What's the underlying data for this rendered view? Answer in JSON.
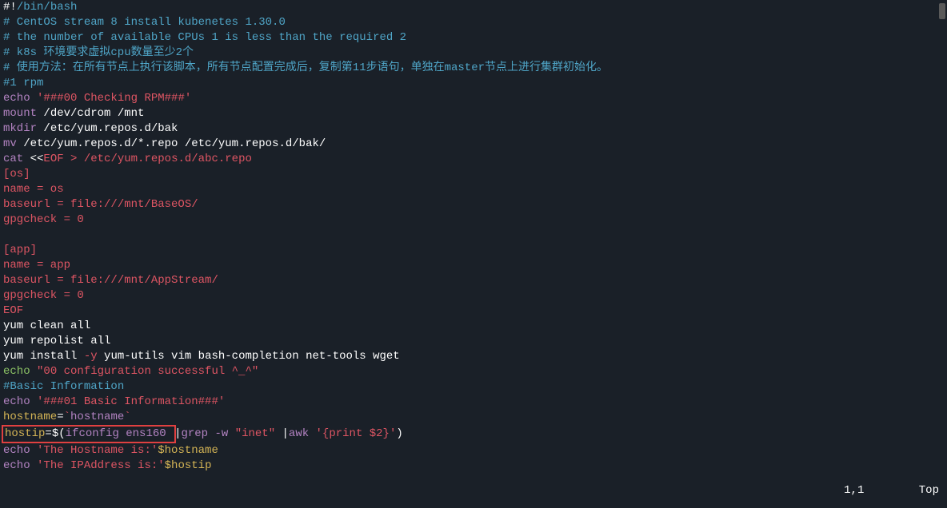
{
  "status": {
    "pos": "1,1",
    "top": "Top"
  },
  "lines": [
    {
      "segs": [
        {
          "t": "#!",
          "c": "white"
        },
        {
          "t": "/bin/bash",
          "c": "comment-blue"
        }
      ]
    },
    {
      "segs": [
        {
          "t": "# CentOS stream 8 install kubenetes 1.30.0",
          "c": "comment-blue"
        }
      ]
    },
    {
      "segs": [
        {
          "t": "# the number of available CPUs 1 is less than the required 2",
          "c": "comment-blue"
        }
      ]
    },
    {
      "segs": [
        {
          "t": "# k8s 环境要求虚拟cpu数量至少2个",
          "c": "comment-blue"
        }
      ]
    },
    {
      "segs": [
        {
          "t": "# 使用方法：在所有节点上执行该脚本，所有节点配置完成后，复制第11步语句，单独在master节点上进行集群初始化。",
          "c": "comment-blue"
        }
      ]
    },
    {
      "segs": [
        {
          "t": "#1 rpm",
          "c": "comment-blue"
        }
      ]
    },
    {
      "segs": [
        {
          "t": "echo ",
          "c": "purple"
        },
        {
          "t": "'###00 Checking RPM###'",
          "c": "red"
        }
      ]
    },
    {
      "segs": [
        {
          "t": "mount ",
          "c": "purple"
        },
        {
          "t": "/dev/cdrom /mnt",
          "c": "white"
        }
      ]
    },
    {
      "segs": [
        {
          "t": "mkdir ",
          "c": "purple"
        },
        {
          "t": "/etc/yum.repos.d/bak",
          "c": "white"
        }
      ]
    },
    {
      "segs": [
        {
          "t": "mv ",
          "c": "purple"
        },
        {
          "t": "/etc/yum.repos.d/*.repo /etc/yum.repos.d/bak/",
          "c": "white"
        }
      ]
    },
    {
      "segs": [
        {
          "t": "cat ",
          "c": "purple"
        },
        {
          "t": "<<",
          "c": "white"
        },
        {
          "t": "EOF",
          "c": "red"
        },
        {
          "t": " > /etc/yum.repos.d/abc.repo",
          "c": "red"
        }
      ]
    },
    {
      "segs": [
        {
          "t": "[os]",
          "c": "red"
        }
      ]
    },
    {
      "segs": [
        {
          "t": "name = os",
          "c": "red"
        }
      ]
    },
    {
      "segs": [
        {
          "t": "baseurl = file:///mnt/BaseOS/",
          "c": "red"
        }
      ]
    },
    {
      "segs": [
        {
          "t": "gpgcheck = 0",
          "c": "red"
        }
      ]
    },
    {
      "segs": [
        {
          "t": "",
          "c": "red"
        }
      ]
    },
    {
      "segs": [
        {
          "t": "[app]",
          "c": "red"
        }
      ]
    },
    {
      "segs": [
        {
          "t": "name = app",
          "c": "red"
        }
      ]
    },
    {
      "segs": [
        {
          "t": "baseurl = file:///mnt/AppStream/",
          "c": "red"
        }
      ]
    },
    {
      "segs": [
        {
          "t": "gpgcheck = 0",
          "c": "red"
        }
      ]
    },
    {
      "segs": [
        {
          "t": "EOF",
          "c": "red"
        }
      ]
    },
    {
      "segs": [
        {
          "t": "yum clean all",
          "c": "white"
        }
      ]
    },
    {
      "segs": [
        {
          "t": "yum repolist all",
          "c": "white"
        }
      ]
    },
    {
      "segs": [
        {
          "t": "yum install ",
          "c": "white"
        },
        {
          "t": "-y",
          "c": "red"
        },
        {
          "t": " yum-utils vim bash-completion net-tools wget",
          "c": "white"
        }
      ]
    },
    {
      "segs": [
        {
          "t": "echo ",
          "c": "green"
        },
        {
          "t": "\"00 configuration successful ^_^\"",
          "c": "red"
        }
      ]
    },
    {
      "segs": [
        {
          "t": "#Basic Information",
          "c": "cyan"
        }
      ]
    },
    {
      "segs": [
        {
          "t": "echo ",
          "c": "purple"
        },
        {
          "t": "'###01 Basic Information###'",
          "c": "red"
        }
      ]
    },
    {
      "segs": [
        {
          "t": "hostname",
          "c": "yellow"
        },
        {
          "t": "=",
          "c": "white"
        },
        {
          "t": "`",
          "c": "red"
        },
        {
          "t": "hostname",
          "c": "purple"
        },
        {
          "t": "`",
          "c": "red"
        }
      ]
    },
    {
      "segs": [
        {
          "t": "hostip",
          "c": "yellow",
          "boxed": true
        },
        {
          "t": "=$(",
          "c": "white",
          "boxed": true
        },
        {
          "t": "ifconfig ens160 ",
          "c": "purple",
          "boxed": true
        },
        {
          "t": "|",
          "c": "white"
        },
        {
          "t": "grep -w ",
          "c": "purple"
        },
        {
          "t": "\"inet\"",
          "c": "red"
        },
        {
          "t": " |",
          "c": "white"
        },
        {
          "t": "awk ",
          "c": "purple"
        },
        {
          "t": "'{print $2}'",
          "c": "red"
        },
        {
          "t": ")",
          "c": "white"
        }
      ]
    },
    {
      "segs": [
        {
          "t": "echo ",
          "c": "purple"
        },
        {
          "t": "'The Hostname is:'",
          "c": "red"
        },
        {
          "t": "$hostname",
          "c": "yellow"
        }
      ]
    },
    {
      "segs": [
        {
          "t": "echo ",
          "c": "purple"
        },
        {
          "t": "'The IPAddress is:'",
          "c": "red"
        },
        {
          "t": "$hostip",
          "c": "yellow"
        }
      ]
    }
  ]
}
